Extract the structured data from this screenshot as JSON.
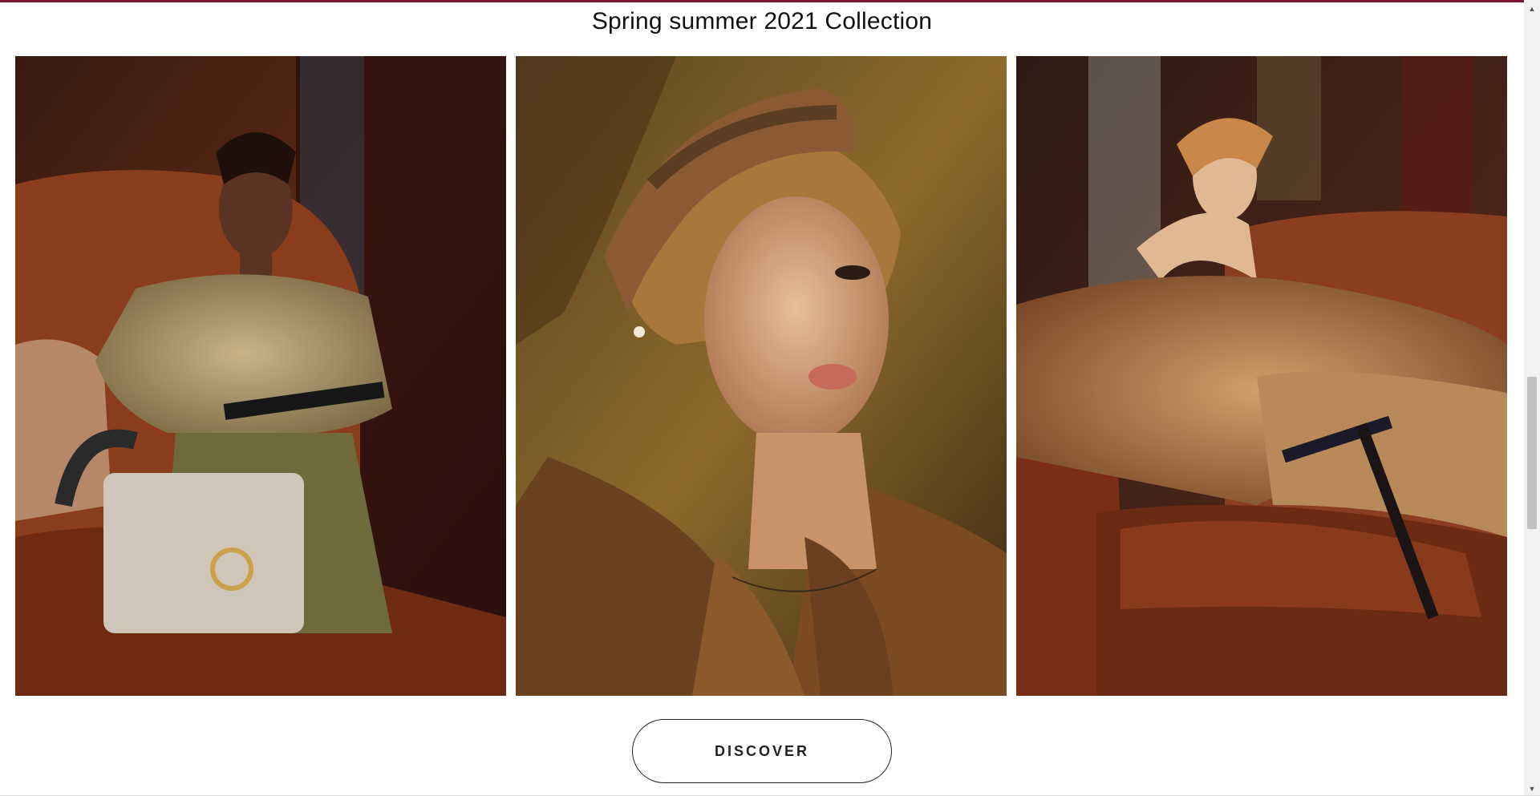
{
  "section": {
    "title": "Spring summer 2021 Collection"
  },
  "gallery": {
    "photos": [
      {
        "icon": "model-seated-with-handbag-image"
      },
      {
        "icon": "model-portrait-with-headband-image"
      },
      {
        "icon": "model-reclining-on-sofa-image"
      }
    ]
  },
  "cta": {
    "discover_label": "DISCOVER"
  },
  "colors": {
    "accent_border": "#7a1230",
    "button_border": "#222222"
  },
  "scrollbar": {
    "up_icon": "chevron-up-icon",
    "down_icon": "chevron-down-icon"
  }
}
